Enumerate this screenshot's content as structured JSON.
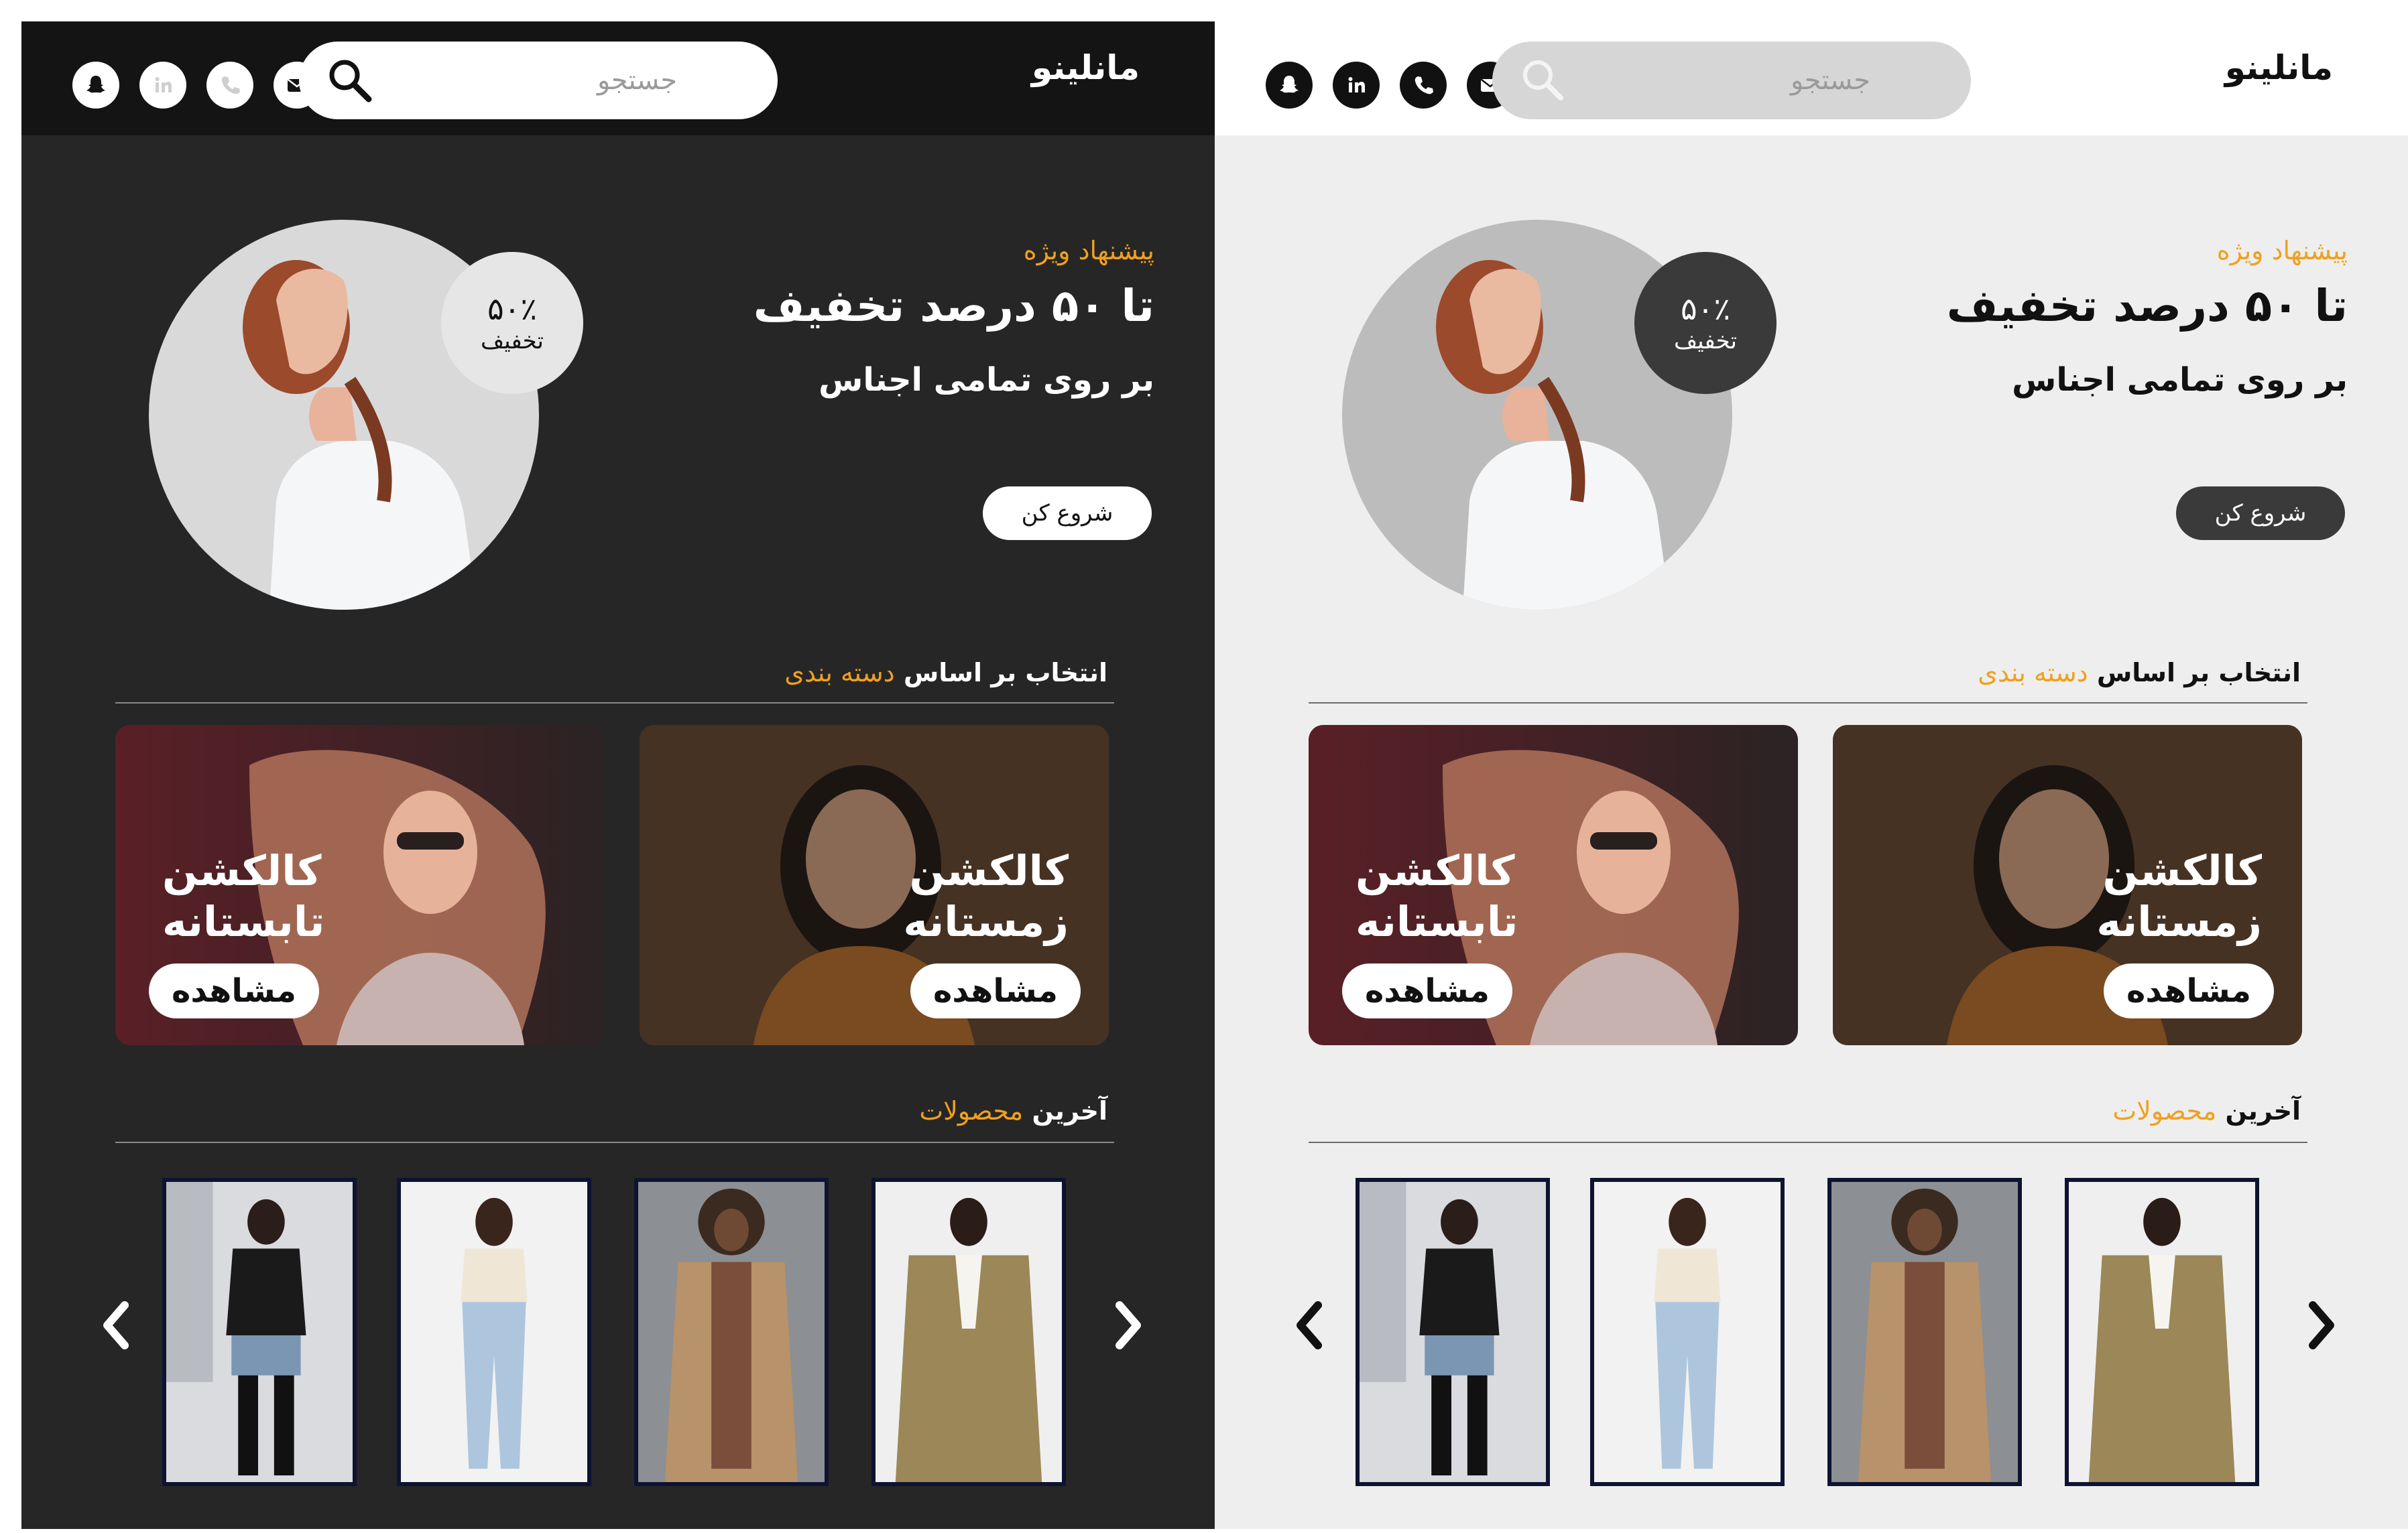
{
  "brand": "مانلینو",
  "search": {
    "placeholder": "جستجو"
  },
  "social_icons": [
    "snapchat-icon",
    "linkedin-icon",
    "phone-icon",
    "mail-icon",
    "home-icon"
  ],
  "hero": {
    "kicker": "پیشنهاد ویژه",
    "headline": "تا ۵۰ درصد تخفیف",
    "subline": "بر روی تمامی اجناس",
    "cta": "شروع کن",
    "badge_percent": "۵۰٪",
    "badge_label": "تخفیف"
  },
  "categories_section": {
    "title_prefix": "انتخاب بر اساس",
    "title_accent": "دسته بندی"
  },
  "categories": [
    {
      "line1": "کالکشن",
      "line2": "زمستانه",
      "button": "مشاهده"
    },
    {
      "line1": "کالکشن",
      "line2": "تابستانه",
      "button": "مشاهده"
    }
  ],
  "products_section": {
    "title_prefix": "آخرین",
    "title_accent": "محصولات"
  },
  "colors": {
    "accent": "#f0a01e",
    "dark_bg": "#262626",
    "dark_header": "#141414",
    "light_bg": "#eeeeee",
    "frame": "#0d1330"
  }
}
